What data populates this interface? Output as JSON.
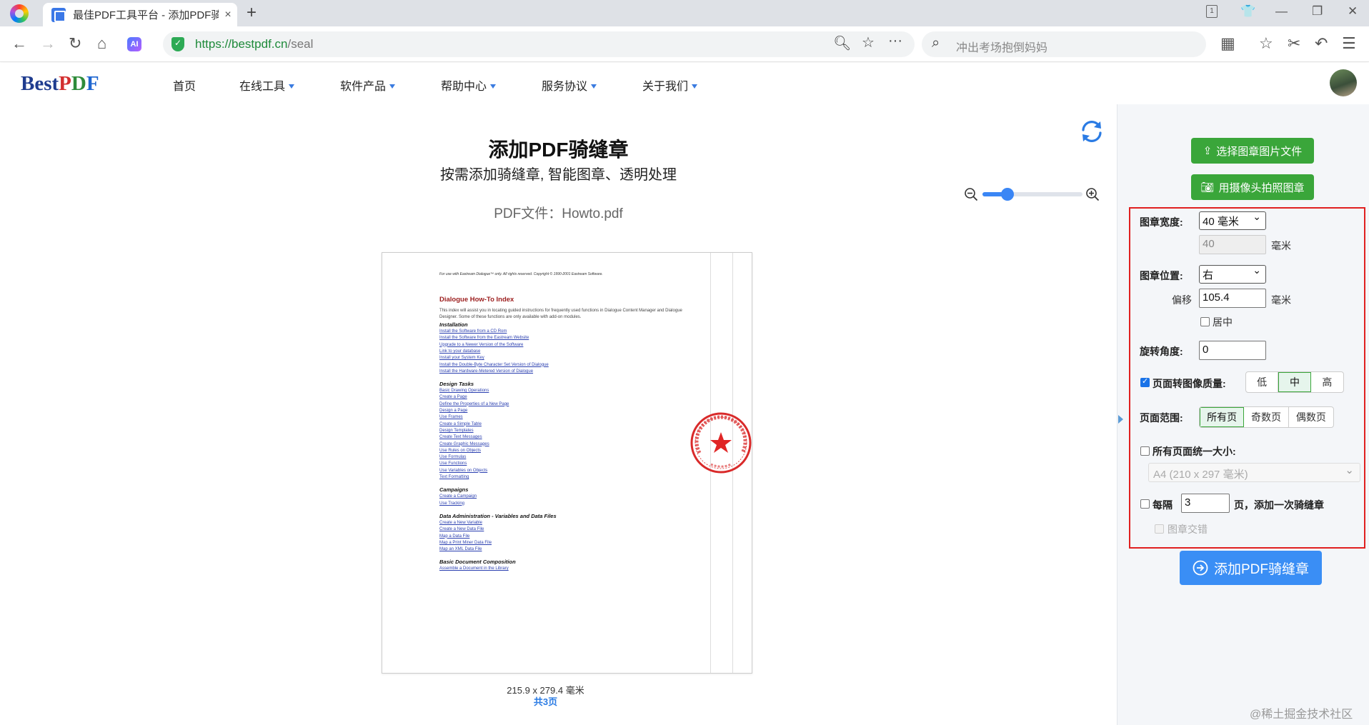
{
  "browser": {
    "tab_title": "最佳PDF工具平台 - 添加PDF骑",
    "tab_close": "×",
    "new_tab": "+",
    "url_host": "https://bestpdf.cn",
    "url_path": "/seal",
    "search_placeholder": "冲出考场抱倒妈妈",
    "ai_badge": "AI"
  },
  "site": {
    "logo_best": "Best",
    "logo_p": "P",
    "logo_d": "D",
    "logo_f": "F",
    "nav": [
      "首页",
      "在线工具",
      "软件产品",
      "帮助中心",
      "服务协议",
      "关于我们"
    ]
  },
  "main": {
    "title": "添加PDF骑缝章",
    "subtitle": "按需添加骑缝章, 智能图章、透明处理",
    "file_label": "PDF文件：Howto.pdf",
    "zoom_level": 0.25,
    "page_size": "215.9 x 279.4 毫米",
    "page_count": "共3页"
  },
  "document": {
    "header": "For use with Eastream Dialogue™ only. All rights reserved. Copyright © 1990-2001 Eastream Software.",
    "title": "Dialogue How-To Index",
    "intro": "This index will assist you in locating guided instructions for frequently used functions in Dialogue Content Manager and Dialogue Designer. Some of these functions are only available with add-on modules.",
    "sections": [
      {
        "heading": "Installation",
        "links": [
          "Install the Software from a CD Rom",
          "Install the Software from the Eastream Website",
          "Upgrade to a Newer Version of the Software",
          "Link to your database",
          "Install your System Key",
          "Install the Double-Byte Character Set Version of Dialogue",
          "Install the Hardware-Metered Version of Dialogue"
        ]
      },
      {
        "heading": "Design Tasks",
        "links": [
          "Basic Drawing Operations",
          "Create a Page",
          "Define the Properties of a New Page",
          "Design a Page",
          "Use Frames",
          "Create a Simple Table",
          "Design Templates",
          "Create Text Messages",
          "Create Graphic Messages",
          "Use Rules on Objects",
          "Use Formulas",
          "Use Functions",
          "Use Variables on Objects",
          "Text Formatting"
        ]
      },
      {
        "heading": "Campaigns",
        "links": [
          "Create a Campaign",
          "Use Tracking"
        ]
      },
      {
        "heading": "Data Administration - Variables and Data Files",
        "links": [
          "Create a New Variable",
          "Create a New Data File",
          "Map a Data File",
          "Map a Print Miner Data File",
          "Map an XML Data File"
        ]
      },
      {
        "heading": "Basic Document Composition",
        "links": [
          "Assemble a Document in the Library"
        ]
      }
    ]
  },
  "sidebar": {
    "choose_image_button": "选择图章图片文件",
    "camera_button": "用摄像头拍照图章",
    "width_label": "图章宽度:",
    "width_select": "40 毫米",
    "width_value": "40",
    "unit_mm": "毫米",
    "position_label": "图章位置:",
    "position_select": "右",
    "offset_label": "偏移",
    "offset_value": "105.4",
    "center_label": "居中",
    "center_checked": false,
    "rotation_label": "旋转角度:",
    "rotation_value": "0",
    "quality_label": "页面转图像质量:",
    "quality_checked": true,
    "quality_options": [
      "低",
      "中",
      "高"
    ],
    "quality_selected": "中",
    "range_label": "页面范围:",
    "range_options": [
      "所有页",
      "奇数页",
      "偶数页"
    ],
    "range_selected": "所有页",
    "unify_label": "所有页面统一大小:",
    "unify_checked": false,
    "paper_select": "A4 (210 x 297 毫米)",
    "every_label": "每隔",
    "every_value": "3",
    "every_suffix": "页，添加一次骑缝章",
    "every_checked": false,
    "stagger_label": "图章交错",
    "add_button": "添加PDF骑缝章"
  },
  "watermark": "@稀土掘金技术社区",
  "colors": {
    "accent": "#3a8ef5",
    "green": "#3aa63a",
    "highlight": "#e02020"
  }
}
